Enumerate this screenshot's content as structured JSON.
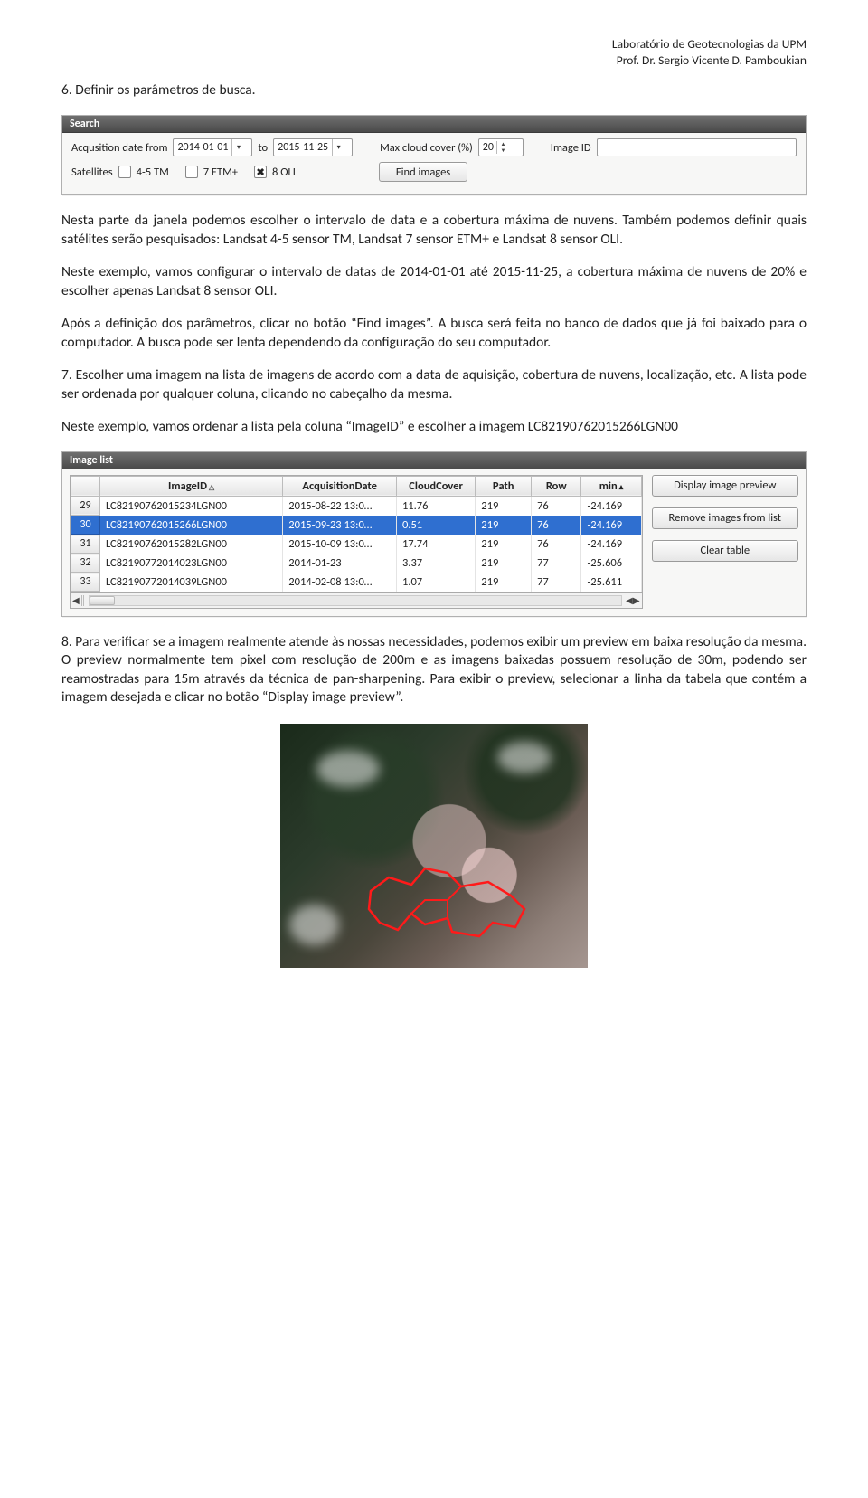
{
  "header": {
    "line1": "Laboratório de Geotecnologias da UPM",
    "line2": "Prof. Dr. Sergio Vicente D. Pamboukian"
  },
  "title6": "6. Definir os parâmetros de busca.",
  "search_panel": {
    "title": "Search",
    "labels": {
      "acq_from": "Acqusition date from",
      "to": "to",
      "max_cloud": "Max cloud cover (%)",
      "image_id": "Image ID",
      "satellites": "Satellites",
      "sat45": "4-5 TM",
      "sat7": "7 ETM+",
      "sat8": "8 OLI",
      "find": "Find images"
    },
    "values": {
      "date_from": "2014-01-01",
      "date_to": "2015-11-25",
      "cloud": "20"
    }
  },
  "para1": "Nesta parte da janela podemos escolher o intervalo de data e a cobertura máxima de nuvens. Também podemos definir quais satélites serão pesquisados: Landsat 4-5 sensor TM, Landsat 7 sensor ETM+ e Landsat 8 sensor OLI.",
  "para2": "Neste exemplo, vamos configurar o intervalo de datas de 2014-01-01 até 2015-11-25, a cobertura máxima de nuvens de 20% e escolher apenas Landsat 8 sensor OLI.",
  "para3": "Após a definição dos parâmetros, clicar no botão “Find images”. A busca será feita no banco de dados que já foi baixado para o computador. A busca pode ser lenta dependendo da configuração do seu computador.",
  "para4": "7. Escolher uma imagem na lista de imagens de acordo com a data de aquisição, cobertura de nuvens, localização, etc. A lista pode ser ordenada por qualquer coluna, clicando no cabeçalho da mesma.",
  "para5": "Neste exemplo, vamos ordenar a lista pela coluna “ImageID” e escolher a imagem LC82190762015266LGN00",
  "imagelist_panel": {
    "title": "Image list",
    "headers": [
      "",
      "ImageID",
      "AcquisitionDate",
      "CloudCover",
      "Path",
      "Row",
      "min"
    ],
    "rows": [
      {
        "n": "29",
        "id": "LC82190762015234LGN00",
        "date": "2015-08-22 13:0…",
        "cloud": "11.76",
        "path": "219",
        "row": "76",
        "min": "-24.169",
        "sel": false
      },
      {
        "n": "30",
        "id": "LC82190762015266LGN00",
        "date": "2015-09-23 13:0…",
        "cloud": "0.51",
        "path": "219",
        "row": "76",
        "min": "-24.169",
        "sel": true
      },
      {
        "n": "31",
        "id": "LC82190762015282LGN00",
        "date": "2015-10-09 13:0…",
        "cloud": "17.74",
        "path": "219",
        "row": "76",
        "min": "-24.169",
        "sel": false
      },
      {
        "n": "32",
        "id": "LC82190772014023LGN00",
        "date": "2014-01-23",
        "cloud": "3.37",
        "path": "219",
        "row": "77",
        "min": "-25.606",
        "sel": false
      },
      {
        "n": "33",
        "id": "LC82190772014039LGN00",
        "date": "2014-02-08 13:0…",
        "cloud": "1.07",
        "path": "219",
        "row": "77",
        "min": "-25.611",
        "sel": false
      }
    ],
    "buttons": {
      "preview": "Display image preview",
      "remove": "Remove images from list",
      "clear": "Clear table"
    }
  },
  "para6": "8. Para verificar se a imagem realmente atende às nossas necessidades, podemos exibir um preview em baixa resolução da mesma. O preview normalmente tem pixel com resolução de 200m e as imagens baixadas possuem resolução de 30m, podendo ser reamostradas para 15m através da técnica de pan-sharpening. Para exibir o preview, selecionar a linha da tabela que contém a imagem desejada e clicar no botão “Display image preview”."
}
